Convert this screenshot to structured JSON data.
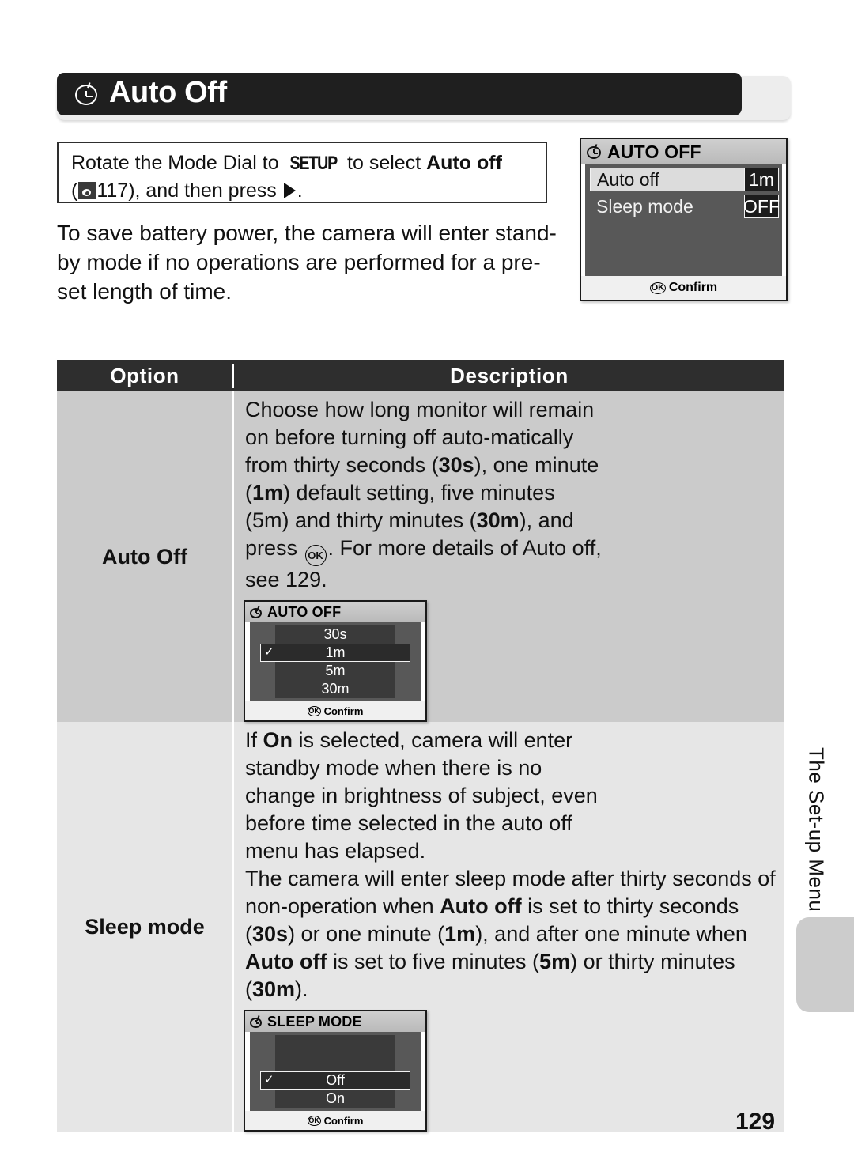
{
  "page": {
    "number": "129",
    "side_tab_label": "The Set-up Menu"
  },
  "header": {
    "title": "Auto Off",
    "icon": "clock-icon"
  },
  "instruction_box": {
    "text_part1": "Rotate the Mode Dial to ",
    "setup_glyph": "SETUP",
    "text_part2": " to select ",
    "bold_target": "Auto off",
    "text_part3": "(",
    "ref_page": "117",
    "text_part4": "), and then press ",
    "text_part5": ".",
    "ref_icon": "book-reference-icon",
    "press_icon": "triangle-right-icon"
  },
  "intro_paragraph": "To save battery power, the camera will enter stand-by mode if no operations are performed for a pre-set length of time.",
  "lcd_top": {
    "title": "AUTO OFF",
    "icon": "clock-icon",
    "rows": [
      {
        "label": "Auto off",
        "value": "1m",
        "selected": true,
        "arrow": "triangle-right-icon"
      },
      {
        "label": "Sleep mode",
        "value": "OFF",
        "selected": false
      }
    ],
    "footer_label": "Confirm",
    "footer_badge": "OK"
  },
  "table": {
    "headers": {
      "option": "Option",
      "description": "Description"
    },
    "rows": [
      {
        "option": "Auto Off",
        "description_runs": [
          {
            "t": "Choose how long monitor will remain on before turning off auto-matically from thirty seconds ("
          },
          {
            "t": "30s",
            "b": true
          },
          {
            "t": "), one minute ("
          },
          {
            "t": "1m",
            "b": true
          },
          {
            "t": ") default setting, five minutes (5m) and thirty minutes ("
          },
          {
            "t": "30m",
            "b": true
          },
          {
            "t": "), and press "
          },
          {
            "t": "OK_ICON",
            "icon": true
          },
          {
            "t": ". For more details of Auto off, see 129."
          }
        ],
        "lcd": {
          "title": "AUTO OFF",
          "icon": "clock-icon",
          "options": [
            "30s",
            "1m",
            "5m",
            "30m"
          ],
          "selected": "1m",
          "footer_label": "Confirm",
          "footer_badge": "OK"
        }
      },
      {
        "option": "Sleep mode",
        "description_runs_narrow": [
          {
            "t": "If "
          },
          {
            "t": "On",
            "b": true
          },
          {
            "t": " is selected, camera will enter standby mode when there is no change in brightness of subject, even before time selected in the auto off menu has elapsed."
          }
        ],
        "description_runs_full": [
          {
            "t": "The camera will enter sleep mode after thirty seconds of non-operation when "
          },
          {
            "t": "Auto off",
            "b": true
          },
          {
            "t": " is set to thirty seconds ("
          },
          {
            "t": "30s",
            "b": true
          },
          {
            "t": ") or one minute ("
          },
          {
            "t": "1m",
            "b": true
          },
          {
            "t": "), and after one minute when "
          },
          {
            "t": "Auto off",
            "b": true
          },
          {
            "t": " is set to five minutes ("
          },
          {
            "t": "5m",
            "b": true
          },
          {
            "t": ") or thirty minutes ("
          },
          {
            "t": "30m",
            "b": true
          },
          {
            "t": ")."
          }
        ],
        "lcd": {
          "title": "SLEEP MODE",
          "icon": "clock-icon",
          "options": [
            "Off",
            "On"
          ],
          "selected": "Off",
          "footer_label": "Confirm",
          "footer_badge": "OK"
        }
      }
    ]
  },
  "colors": {
    "header_bar": "#1f1f1f",
    "table_header": "#2e2e2e",
    "row1_bg": "#cbcbcb",
    "row2_bg": "#e6e6e6",
    "lcd_body": "#585858",
    "side_tab": "#cccccc"
  }
}
